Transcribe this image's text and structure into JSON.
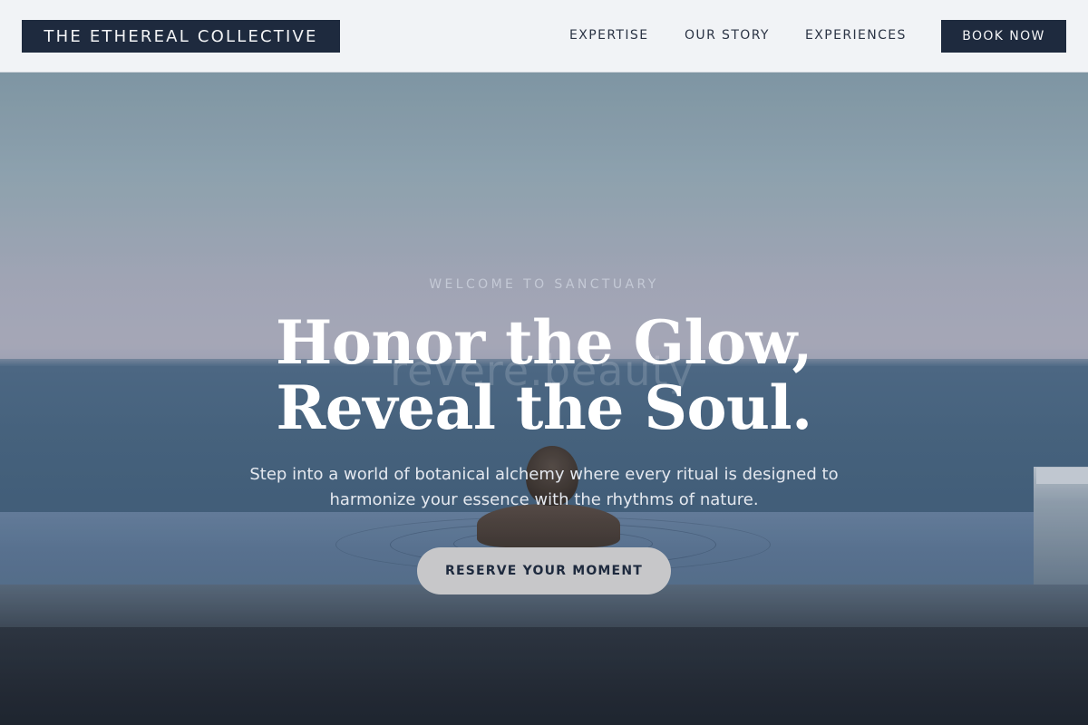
{
  "header": {
    "logo": "THE ETHEREAL COLLECTIVE",
    "nav": [
      {
        "label": "EXPERTISE"
      },
      {
        "label": "OUR STORY"
      },
      {
        "label": "EXPERIENCES"
      }
    ],
    "cta": "BOOK NOW"
  },
  "hero": {
    "eyebrow": "WELCOME TO SANCTUARY",
    "headline_line1": "Honor the Glow,",
    "headline_line2": "Reveal the Soul.",
    "subline_line1": "Step into a world of botanical alchemy where every ritual is designed to",
    "subline_line2": "harmonize your essence with the rhythms of nature.",
    "cta": "RESERVE YOUR MOMENT",
    "watermark": "revere.beauty"
  },
  "colors": {
    "navy": "#1e2a3e",
    "header_bg": "#f1f3f6",
    "cta_pill": "#c7c7c9"
  }
}
